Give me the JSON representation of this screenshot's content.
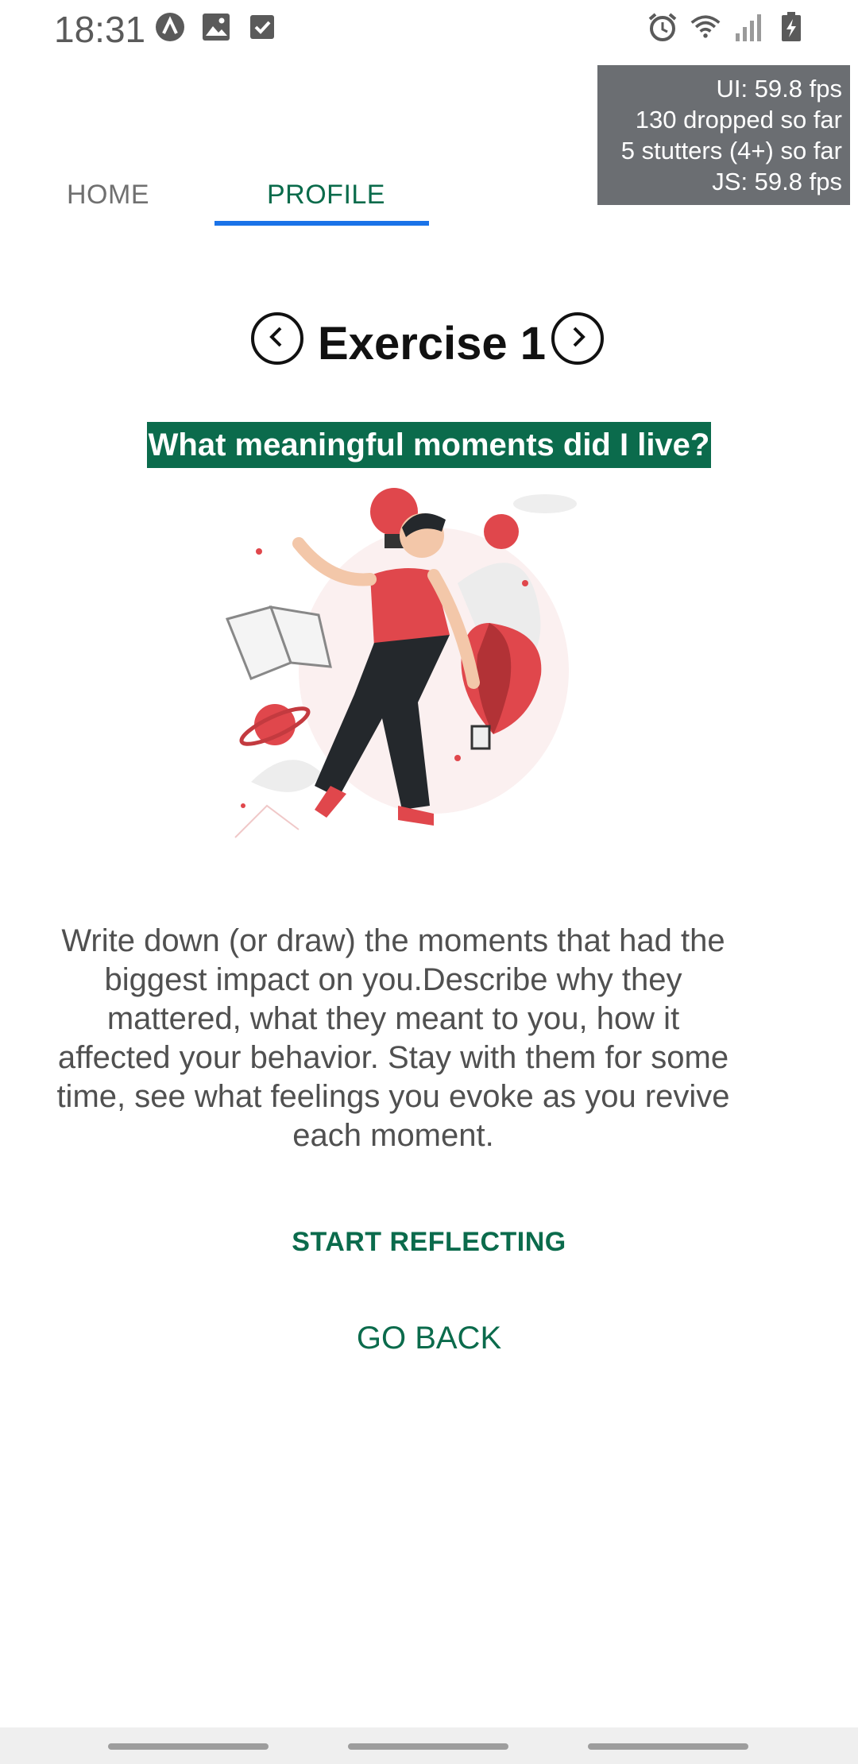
{
  "status_bar": {
    "time": "18:31",
    "left_icons": [
      "app-icon",
      "image-icon",
      "checkbox-icon"
    ],
    "right_icons": [
      "alarm-icon",
      "wifi-icon",
      "signal-icon",
      "battery-charging-icon"
    ]
  },
  "perf_overlay": {
    "ui_fps": "UI: 59.8 fps",
    "dropped": "130 dropped so far",
    "stutters": "5 stutters (4+) so far",
    "js_fps": "JS: 59.8 fps"
  },
  "tabs": [
    {
      "label": "HOME",
      "active": false
    },
    {
      "label": "PROFILE",
      "active": true
    }
  ],
  "exercise": {
    "title": "Exercise 1",
    "question": "What meaningful moments did I live?",
    "description": "Write down (or draw) the moments that had the biggest impact on you.Describe why they mattered, what they meant to you, how it affected your behavior. Stay with them for some time, see what feelings you evoke as you revive each moment."
  },
  "actions": {
    "start_label": "START REFLECTING",
    "back_label": "GO BACK"
  },
  "colors": {
    "accent": "#0b6b4c",
    "tab_indicator": "#1a73e8",
    "illustration_red": "#e0474c"
  }
}
